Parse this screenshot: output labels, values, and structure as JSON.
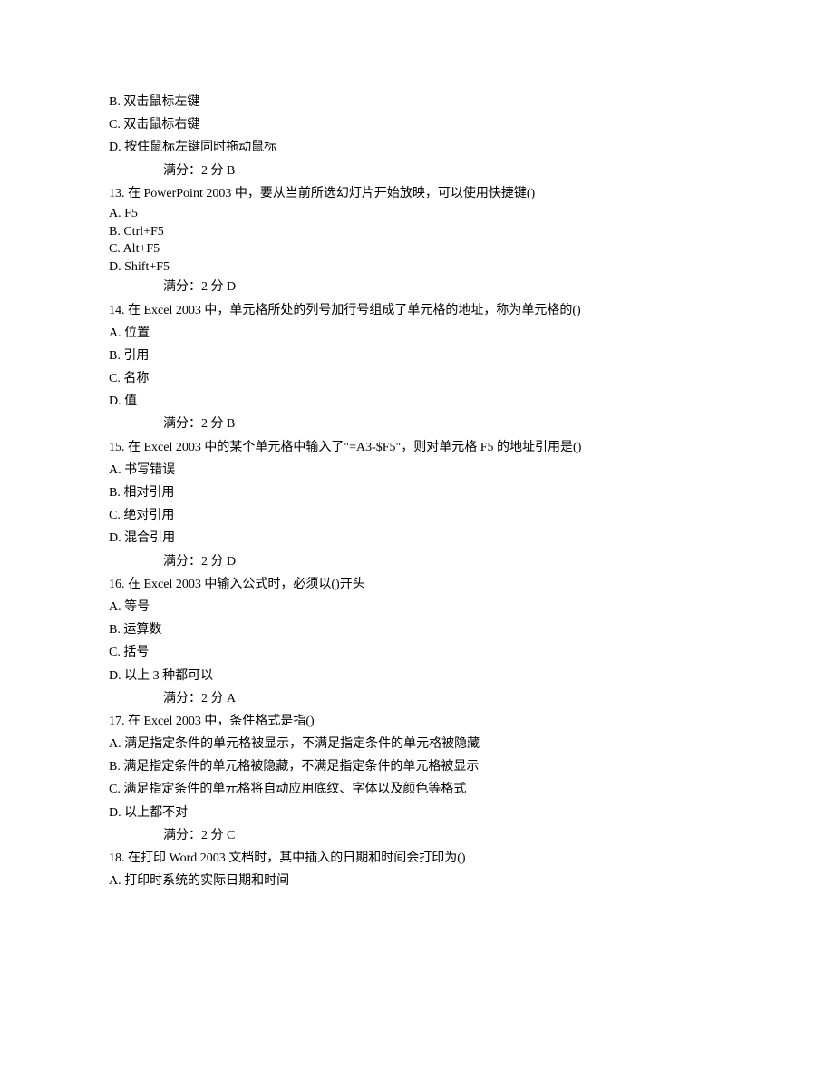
{
  "lines": [
    {
      "text": "B.  双击鼠标左键",
      "cls": "line"
    },
    {
      "text": "C.  双击鼠标右键",
      "cls": "line"
    },
    {
      "text": "D.  按住鼠标左键同时拖动鼠标",
      "cls": "line"
    },
    {
      "text": "满分：2  分  B",
      "cls": "line indent1"
    },
    {
      "text": "13.  在 PowerPoint 2003 中，要从当前所选幻灯片开始放映，可以使用快捷键()",
      "cls": "line"
    },
    {
      "text": "A.  F5",
      "cls": "line tight"
    },
    {
      "text": "B.  Ctrl+F5",
      "cls": "line tight"
    },
    {
      "text": "C.  Alt+F5",
      "cls": "line tight"
    },
    {
      "text": "D.  Shift+F5",
      "cls": "line tight"
    },
    {
      "text": "满分：2  分  D",
      "cls": "line indent1"
    },
    {
      "text": "14.  在 Excel 2003 中，单元格所处的列号加行号组成了单元格的地址，称为单元格的()",
      "cls": "line"
    },
    {
      "text": "A.  位置",
      "cls": "line"
    },
    {
      "text": "B.  引用",
      "cls": "line"
    },
    {
      "text": "C.  名称",
      "cls": "line"
    },
    {
      "text": "D.  值",
      "cls": "line"
    },
    {
      "text": "满分：2  分  B",
      "cls": "line indent1"
    },
    {
      "text": "15.  在 Excel 2003 中的某个单元格中输入了\"=A3-$F5\"，则对单元格 F5 的地址引用是()",
      "cls": "line"
    },
    {
      "text": "A.  书写错误",
      "cls": "line"
    },
    {
      "text": "B.  相对引用",
      "cls": "line"
    },
    {
      "text": "C.  绝对引用",
      "cls": "line"
    },
    {
      "text": "D.  混合引用",
      "cls": "line"
    },
    {
      "text": "满分：2  分  D",
      "cls": "line indent1"
    },
    {
      "text": "16.  在 Excel 2003 中输入公式时，必须以()开头",
      "cls": "line"
    },
    {
      "text": "A.  等号",
      "cls": "line"
    },
    {
      "text": "B.  运算数",
      "cls": "line"
    },
    {
      "text": "C.  括号",
      "cls": "line"
    },
    {
      "text": "D.  以上 3 种都可以",
      "cls": "line"
    },
    {
      "text": "满分：2  分  A",
      "cls": "line indent1"
    },
    {
      "text": "17.  在 Excel 2003 中，条件格式是指()",
      "cls": "line"
    },
    {
      "text": "A.  满足指定条件的单元格被显示，不满足指定条件的单元格被隐藏",
      "cls": "line"
    },
    {
      "text": "B.  满足指定条件的单元格被隐藏，不满足指定条件的单元格被显示",
      "cls": "line"
    },
    {
      "text": "C.  满足指定条件的单元格将自动应用底纹、字体以及颜色等格式",
      "cls": "line"
    },
    {
      "text": "D.  以上都不对",
      "cls": "line"
    },
    {
      "text": "满分：2  分  C",
      "cls": "line indent1"
    },
    {
      "text": "18.  在打印 Word 2003 文档时，其中插入的日期和时间会打印为()",
      "cls": "line"
    },
    {
      "text": "A.  打印时系统的实际日期和时间",
      "cls": "line"
    }
  ]
}
